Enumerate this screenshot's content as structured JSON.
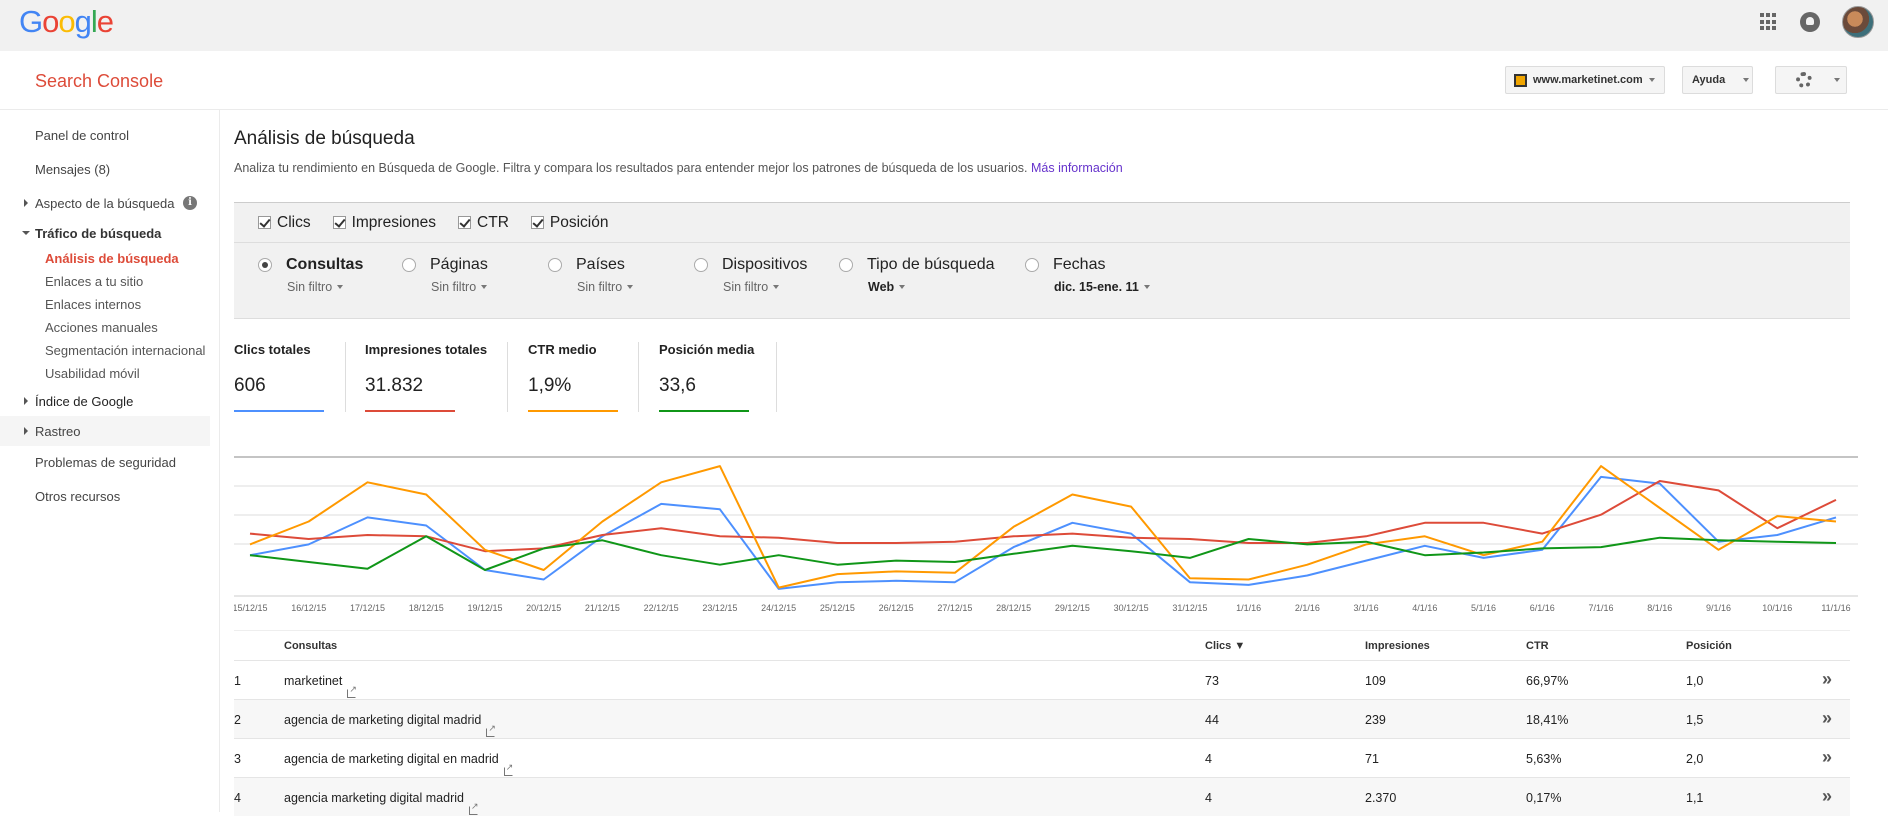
{
  "gbar": {
    "logo": "Google"
  },
  "header": {
    "title": "Search Console",
    "site": "www.marketinet.com",
    "help": "Ayuda"
  },
  "sidebar": {
    "items": [
      {
        "label": "Panel de control"
      },
      {
        "label": "Mensajes (8)"
      },
      {
        "label": "Aspecto de la búsqueda"
      },
      {
        "label": "Tráfico de búsqueda"
      },
      {
        "label": "Análisis de búsqueda"
      },
      {
        "label": "Enlaces a tu sitio"
      },
      {
        "label": "Enlaces internos"
      },
      {
        "label": "Acciones manuales"
      },
      {
        "label": "Segmentación internacional"
      },
      {
        "label": "Usabilidad móvil"
      },
      {
        "label": "Índice de Google"
      },
      {
        "label": "Rastreo"
      },
      {
        "label": "Problemas de seguridad"
      },
      {
        "label": "Otros recursos"
      }
    ]
  },
  "page": {
    "title": "Análisis de búsqueda",
    "description": "Analiza tu rendimiento en Búsqueda de Google. Filtra y compara los resultados para entender mejor los patrones de búsqueda de los usuarios.",
    "more_link": "Más información"
  },
  "metrics": [
    "Clics",
    "Impresiones",
    "CTR",
    "Posición"
  ],
  "groups": [
    {
      "label": "Consultas",
      "filter": "Sin filtro"
    },
    {
      "label": "Páginas",
      "filter": "Sin filtro"
    },
    {
      "label": "Países",
      "filter": "Sin filtro"
    },
    {
      "label": "Dispositivos",
      "filter": "Sin filtro"
    },
    {
      "label": "Tipo de búsqueda",
      "filter": "Web"
    },
    {
      "label": "Fechas",
      "filter": "dic. 15-ene. 11"
    }
  ],
  "totals": [
    {
      "label": "Clics totales",
      "value": "606",
      "color": "#4d90fe"
    },
    {
      "label": "Impresiones totales",
      "value": "31.832",
      "color": "#dd4b39"
    },
    {
      "label": "CTR medio",
      "value": "1,9%",
      "color": "#ff9900"
    },
    {
      "label": "Posición media",
      "value": "33,6",
      "color": "#109618"
    }
  ],
  "chart_data": {
    "type": "line",
    "x": [
      "15/12/15",
      "16/12/15",
      "17/12/15",
      "18/12/15",
      "19/12/15",
      "20/12/15",
      "21/12/15",
      "22/12/15",
      "23/12/15",
      "24/12/15",
      "25/12/15",
      "26/12/15",
      "27/12/15",
      "28/12/15",
      "29/12/15",
      "30/12/15",
      "31/12/15",
      "1/1/16",
      "2/1/16",
      "3/1/16",
      "4/1/16",
      "5/1/16",
      "6/1/16",
      "7/1/16",
      "8/1/16",
      "9/1/16",
      "10/1/16",
      "11/1/16"
    ],
    "ylim": [
      0,
      100
    ],
    "series": [
      {
        "name": "Clics totales",
        "color": "#4d90fe",
        "values": [
          28,
          36,
          56,
          50,
          17,
          10,
          42,
          66,
          62,
          3,
          8,
          9,
          8,
          34,
          52,
          44,
          8,
          6,
          13,
          24,
          35,
          26,
          32,
          86,
          81,
          38,
          43,
          56
        ]
      },
      {
        "name": "Impresiones totales",
        "color": "#dd4b39",
        "values": [
          44,
          40,
          43,
          42,
          31,
          33,
          43,
          48,
          42,
          41,
          37,
          37,
          38,
          42,
          44,
          41,
          40,
          37,
          37,
          42,
          52,
          52,
          44,
          58,
          83,
          76,
          48,
          69
        ]
      },
      {
        "name": "CTR medio",
        "color": "#ff9900",
        "values": [
          36,
          53,
          82,
          73,
          32,
          17,
          53,
          82,
          94,
          4,
          14,
          16,
          15,
          49,
          73,
          64,
          11,
          10,
          21,
          36,
          42,
          28,
          38,
          94,
          63,
          32,
          57,
          53
        ]
      },
      {
        "name": "Posición media",
        "color": "#109618",
        "values": [
          28,
          23,
          18,
          42,
          17,
          33,
          39,
          28,
          21,
          28,
          21,
          24,
          23,
          29,
          35,
          31,
          26,
          40,
          36,
          38,
          28,
          30,
          33,
          34,
          41,
          39,
          38,
          37
        ]
      }
    ]
  },
  "table": {
    "headers": [
      "Consultas",
      "Clics ▼",
      "Impresiones",
      "CTR",
      "Posición"
    ],
    "rows": [
      {
        "n": "1",
        "query": "marketinet",
        "clicks": "73",
        "impr": "109",
        "ctr": "66,97%",
        "pos": "1,0"
      },
      {
        "n": "2",
        "query": "agencia de marketing digital madrid",
        "clicks": "44",
        "impr": "239",
        "ctr": "18,41%",
        "pos": "1,5"
      },
      {
        "n": "3",
        "query": "agencia de marketing digital en madrid",
        "clicks": "4",
        "impr": "71",
        "ctr": "5,63%",
        "pos": "2,0"
      },
      {
        "n": "4",
        "query": "agencia marketing digital madrid",
        "clicks": "4",
        "impr": "2.370",
        "ctr": "0,17%",
        "pos": "1,1"
      }
    ],
    "more_glyph": "»"
  }
}
